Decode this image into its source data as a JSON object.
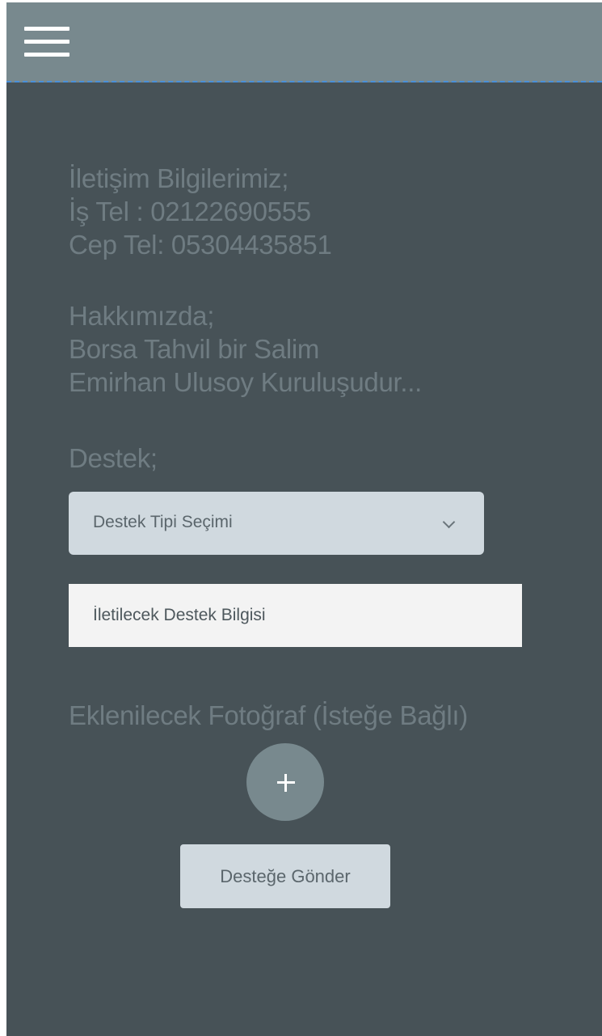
{
  "header": {
    "menu_icon": "hamburger-menu-icon"
  },
  "contact": {
    "title": "İletişim Bilgilerimiz;",
    "work_phone": "İş Tel : 02122690555",
    "mobile_phone": "Cep Tel: 05304435851"
  },
  "about": {
    "title": "Hakkımızda;",
    "line1": "Borsa Tahvil bir Salim",
    "line2": "Emirhan Ulusoy Kuruluşudur..."
  },
  "support": {
    "title": "Destek;",
    "type_select_label": "Destek Tipi Seçimi",
    "message_placeholder": "İletilecek Destek Bilgisi",
    "photo_label": "Eklenilecek Fotoğraf (İsteğe Bağlı)",
    "add_photo_icon": "plus-icon",
    "submit_label": "Desteğe Gönder"
  },
  "colors": {
    "header_bg": "#78898e",
    "page_bg": "#475257",
    "muted_text": "#6f7c82",
    "button_bg": "#d0d9df"
  }
}
